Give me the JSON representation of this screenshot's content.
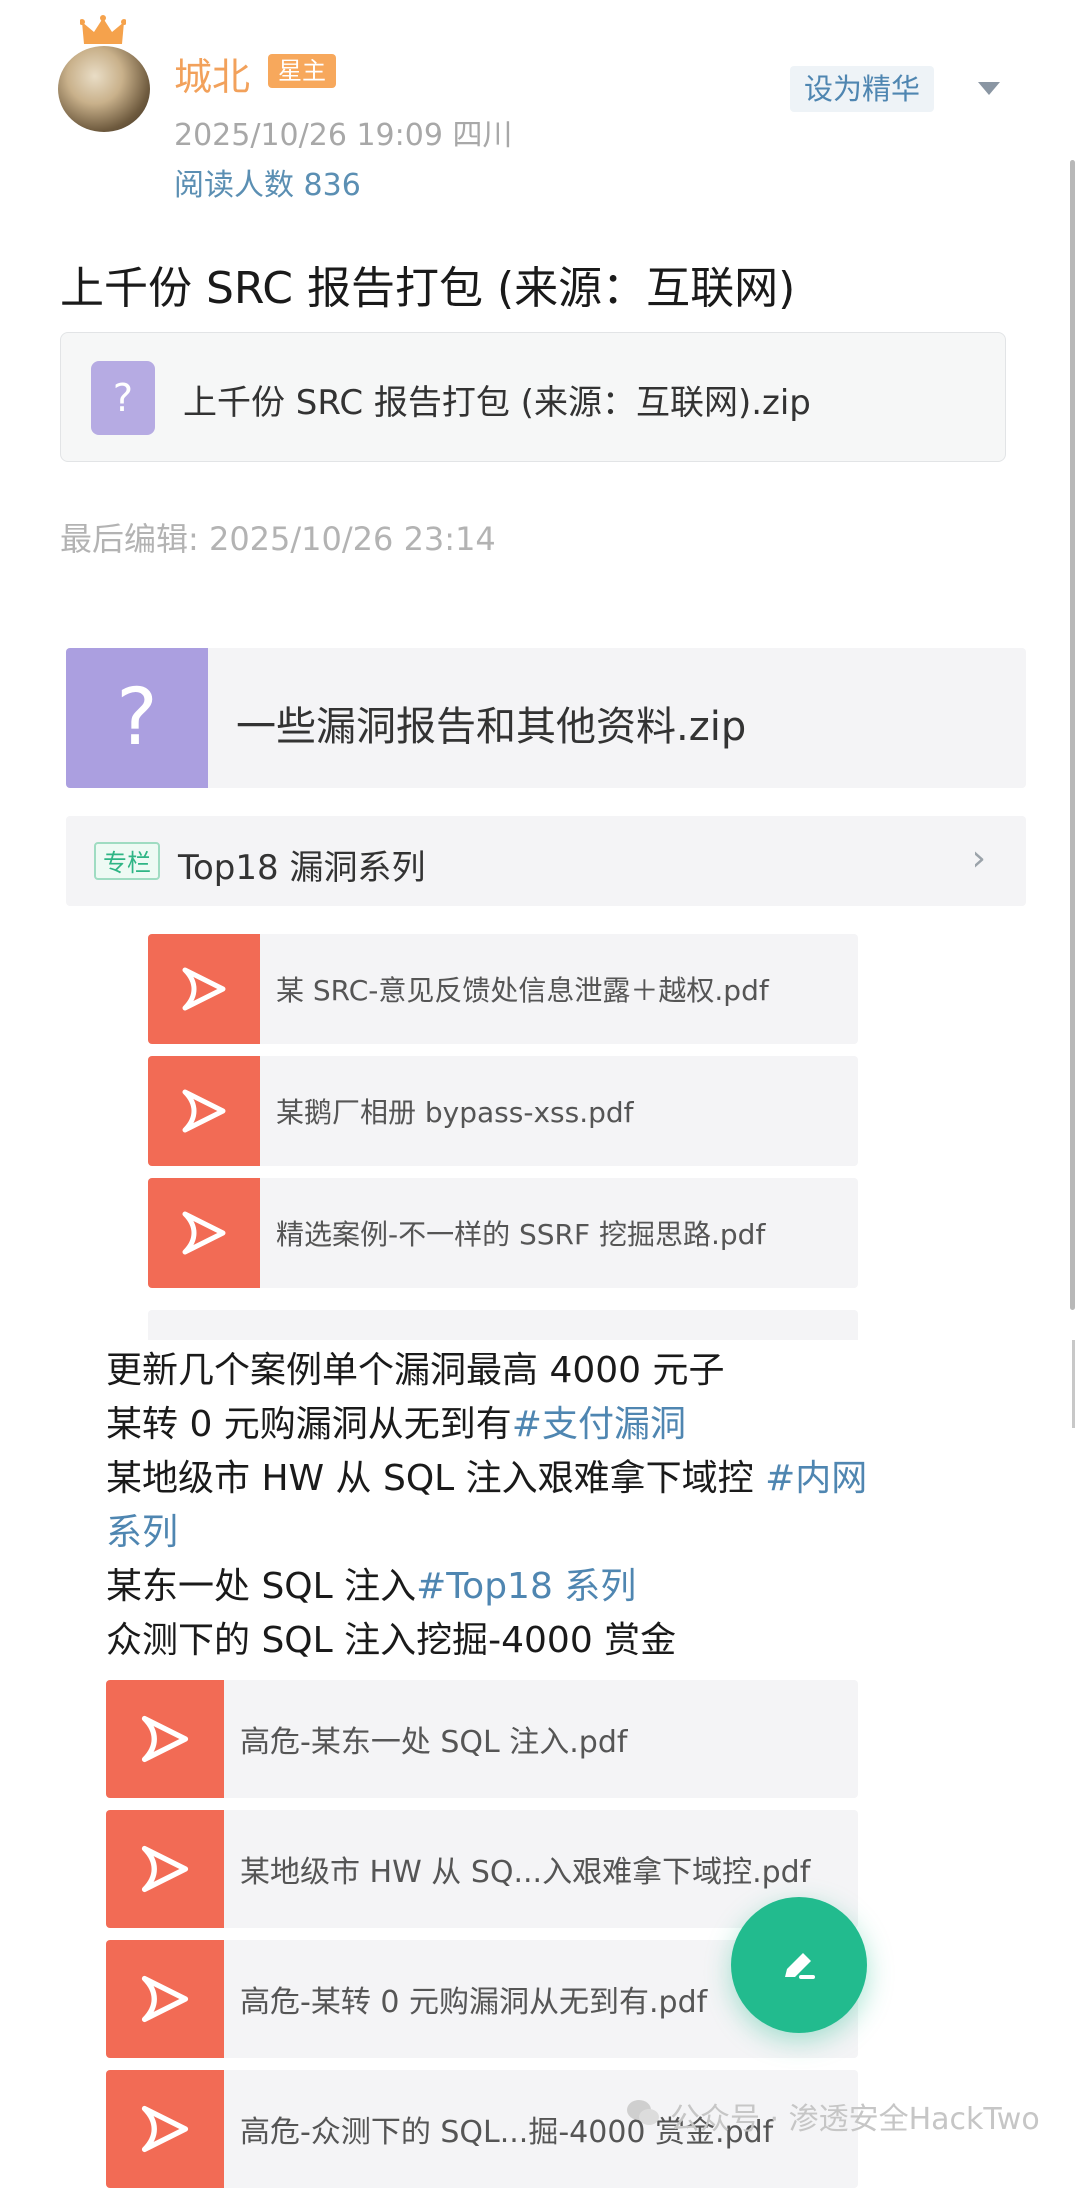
{
  "post": {
    "author": "城北",
    "role_badge": "星主",
    "datetime_location": "2025/10/26 19:09  四川",
    "reads": "阅读人数 836",
    "set_featured": "设为精华",
    "title": "上千份 SRC 报告打包 (来源：互联网)",
    "attachment": "上千份 SRC 报告打包 (来源：互联网).zip",
    "last_edited": "最后编辑: 2025/10/26 23:14"
  },
  "share": {
    "zip_name": "一些漏洞报告和其他资料.zip",
    "column": {
      "tag": "专栏",
      "title": "Top18 漏洞系列"
    },
    "pdfs": [
      "某 SRC-意见反馈处信息泄露＋越权.pdf",
      "某鹅厂相册 bypass-xss.pdf",
      "精选案例-不一样的 SSRF 挖掘思路.pdf"
    ],
    "lines": [
      {
        "text": "更新几个案例单个漏洞最高 4000 元子",
        "tag": ""
      },
      {
        "text": "某转 0 元购漏洞从无到有",
        "tag": "#支付漏洞"
      },
      {
        "text": "某地级市 HW 从 SQL 注入艰难拿下域控 ",
        "tag": "#内网"
      },
      {
        "text": "",
        "tag": "系列"
      },
      {
        "text": "某东一处 SQL 注入",
        "tag": "#Top18 系列"
      },
      {
        "text": "众测下的 SQL 注入挖掘-4000 赏金",
        "tag": ""
      }
    ],
    "pdfs2": [
      "高危-某东一处 SQL 注入.pdf",
      "某地级市 HW 从 SQ...入艰难拿下域控.pdf",
      "高危-某转 0 元购漏洞从无到有.pdf",
      "高危-众测下的 SQL...掘-4000 赏金.pdf"
    ]
  },
  "watermark": "公众号 · 渗透安全HackTwo",
  "icons": [
    "crown-icon",
    "dropdown-triangle-icon",
    "question-file-icon",
    "pdf-icon",
    "chevron-right-icon",
    "edit-pencil-icon",
    "wechat-icon"
  ],
  "colors": {
    "accent_green": "#22bb8e",
    "author_orange": "#f2a15b",
    "pdf_red": "#f26b55",
    "link_blue": "#4f86b1"
  }
}
